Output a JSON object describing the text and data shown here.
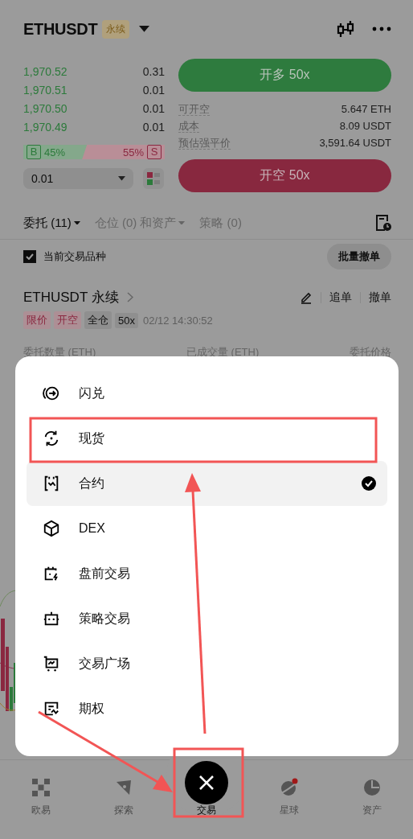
{
  "header": {
    "symbol": "ETHUSDT",
    "badge": "永续"
  },
  "order_book": {
    "rows": [
      {
        "price": "1,970.52",
        "amount": "0.31"
      },
      {
        "price": "1,970.51",
        "amount": "0.01"
      },
      {
        "price": "1,970.50",
        "amount": "0.01"
      },
      {
        "price": "1,970.49",
        "amount": "0.01"
      }
    ],
    "buy": {
      "label": "B",
      "value": "45%",
      "level": 0.45
    },
    "sell": {
      "label": "S",
      "value": "55%"
    },
    "depth": "0.01"
  },
  "trade_panel": {
    "long_button": "开多 50x",
    "info": [
      {
        "label": "可开空",
        "value": "5.647 ETH"
      },
      {
        "label": "成本",
        "value": "8.09 USDT"
      },
      {
        "label": "预估强平价",
        "value": "3,591.64 USDT"
      }
    ],
    "short_button": "开空 50x"
  },
  "tabs": [
    {
      "label": "委托 (11)",
      "selected": true,
      "dropdown": true
    },
    {
      "label": "仓位 (0) 和资产",
      "selected": false,
      "dropdown": true
    },
    {
      "label": "策略 (0)",
      "selected": false,
      "dropdown": false
    }
  ],
  "filter": {
    "label": "当前交易品种",
    "checked": true
  },
  "cancel_all_button": "批量撤单",
  "order": {
    "title": "ETHUSDT 永续",
    "actions": [
      "追单",
      "撤单"
    ],
    "tags": [
      {
        "label": "限价",
        "kind": "sell"
      },
      {
        "label": "开空",
        "kind": "sell"
      },
      {
        "label": "全仓",
        "kind": "plain"
      },
      {
        "label": "50x",
        "kind": "plain"
      }
    ],
    "time": "02/12 14:30:52",
    "columns": [
      "委托数量 (ETH)",
      "已成交量 (ETH)",
      "委托价格"
    ]
  },
  "menu": {
    "items": [
      {
        "label": "闪兑",
        "kind": "convert",
        "selected": false
      },
      {
        "label": "现货",
        "kind": "spot",
        "selected": false
      },
      {
        "label": "合约",
        "kind": "futures",
        "selected": true
      },
      {
        "label": "DEX",
        "kind": "dex",
        "selected": false
      },
      {
        "label": "盘前交易",
        "kind": "premarket",
        "selected": false
      },
      {
        "label": "策略交易",
        "kind": "bot",
        "selected": false
      },
      {
        "label": "交易广场",
        "kind": "square",
        "selected": false
      },
      {
        "label": "期权",
        "kind": "options",
        "selected": false
      }
    ]
  },
  "nav": {
    "items": [
      {
        "label": "欧易",
        "kind": "home",
        "selected": false
      },
      {
        "label": "探索",
        "kind": "explore",
        "selected": false
      },
      {
        "label": "交易",
        "kind": "trade",
        "selected": true
      },
      {
        "label": "星球",
        "kind": "planet",
        "selected": false
      },
      {
        "label": "资产",
        "kind": "assets",
        "selected": false
      }
    ]
  }
}
